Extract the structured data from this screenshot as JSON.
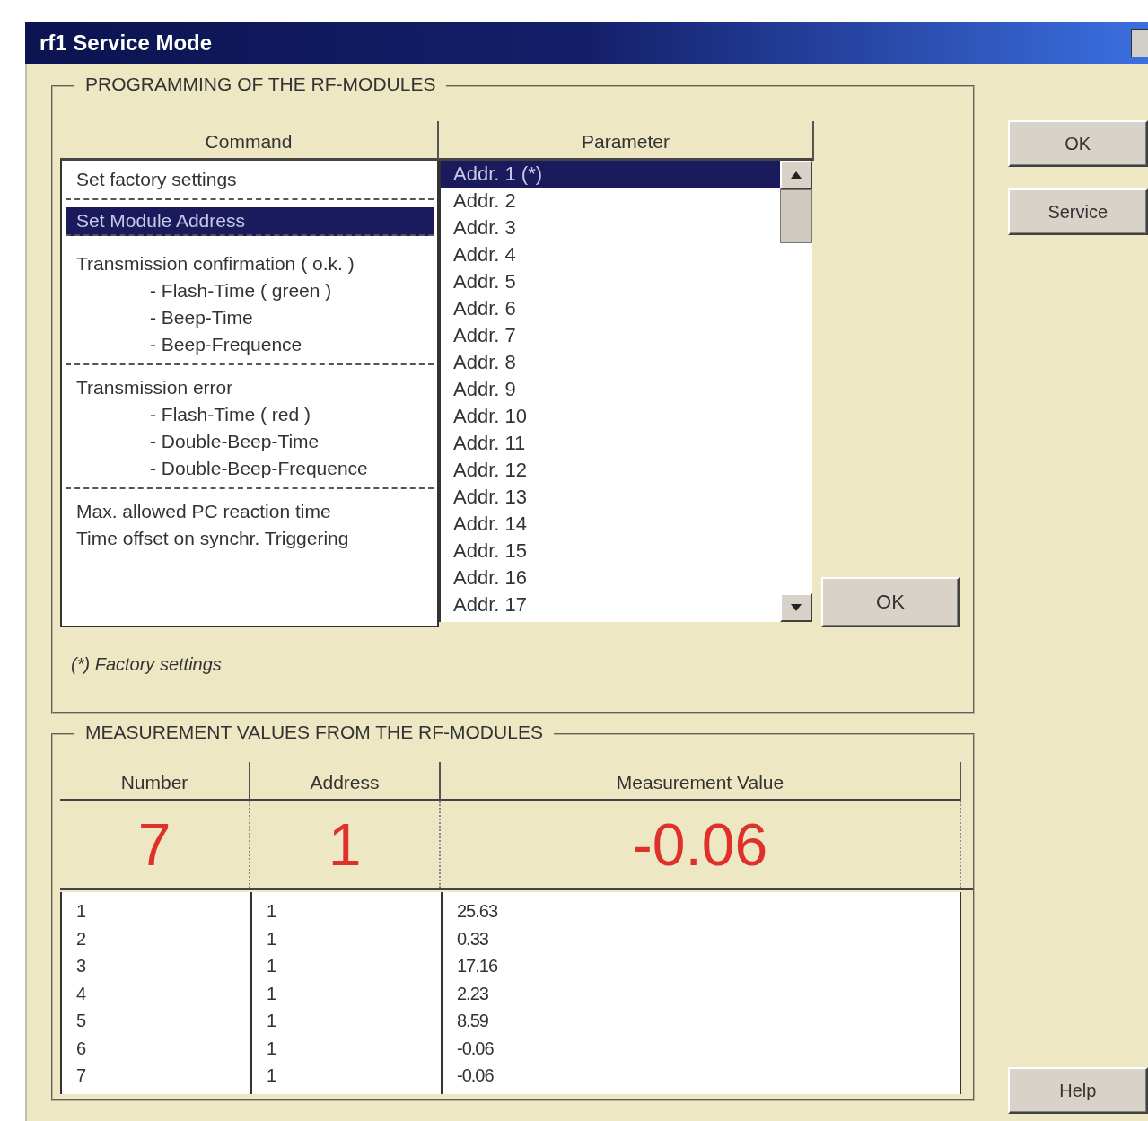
{
  "window": {
    "title": "rf1 Service Mode"
  },
  "programming": {
    "title": "PROGRAMMING OF THE RF-MODULES",
    "columns": [
      "Command",
      "Parameter"
    ],
    "commands": [
      {
        "selected": false,
        "lines": [
          {
            "kind": "main",
            "text": "Set factory settings"
          }
        ]
      },
      {
        "selected": true,
        "lines": [
          {
            "kind": "main",
            "text": "Set Module Address"
          }
        ]
      },
      {
        "selected": false,
        "lines": [
          {
            "kind": "main",
            "text": "Transmission confirmation ( o.k. )"
          },
          {
            "kind": "sub",
            "text": "- Flash-Time ( green )"
          },
          {
            "kind": "sub",
            "text": "- Beep-Time"
          },
          {
            "kind": "sub",
            "text": "- Beep-Frequence"
          }
        ]
      },
      {
        "selected": false,
        "lines": [
          {
            "kind": "main",
            "text": "Transmission error"
          },
          {
            "kind": "sub",
            "text": "- Flash-Time ( red )"
          },
          {
            "kind": "sub",
            "text": "- Double-Beep-Time"
          },
          {
            "kind": "sub",
            "text": "- Double-Beep-Frequence"
          }
        ]
      },
      {
        "selected": false,
        "lines": [
          {
            "kind": "main",
            "text": "Max. allowed PC reaction time"
          },
          {
            "kind": "main",
            "text": "Time offset on synchr. Triggering"
          }
        ]
      }
    ],
    "parameters": [
      {
        "text": "Addr. 1 (*)",
        "selected": true
      },
      {
        "text": "Addr. 2",
        "selected": false
      },
      {
        "text": "Addr. 3",
        "selected": false
      },
      {
        "text": "Addr. 4",
        "selected": false
      },
      {
        "text": "Addr. 5",
        "selected": false
      },
      {
        "text": "Addr. 6",
        "selected": false
      },
      {
        "text": "Addr. 7",
        "selected": false
      },
      {
        "text": "Addr. 8",
        "selected": false
      },
      {
        "text": "Addr. 9",
        "selected": false
      },
      {
        "text": "Addr. 10",
        "selected": false
      },
      {
        "text": "Addr. 11",
        "selected": false
      },
      {
        "text": "Addr. 12",
        "selected": false
      },
      {
        "text": "Addr. 13",
        "selected": false
      },
      {
        "text": "Addr. 14",
        "selected": false
      },
      {
        "text": "Addr. 15",
        "selected": false
      },
      {
        "text": "Addr. 16",
        "selected": false
      },
      {
        "text": "Addr. 17",
        "selected": false
      }
    ],
    "ok_button": "OK",
    "footnote": "(*) Factory settings"
  },
  "measurement": {
    "title": "MEASUREMENT VALUES FROM THE RF-MODULES",
    "columns": [
      "Number",
      "Address",
      "Measurement Value"
    ],
    "current": {
      "number": "7",
      "address": "1",
      "value": "-0.06"
    },
    "rows": [
      {
        "number": "1",
        "address": "1",
        "value": "25.63"
      },
      {
        "number": "2",
        "address": "1",
        "value": "0.33"
      },
      {
        "number": "3",
        "address": "1",
        "value": "17.16"
      },
      {
        "number": "4",
        "address": "1",
        "value": "2.23"
      },
      {
        "number": "5",
        "address": "1",
        "value": "8.59"
      },
      {
        "number": "6",
        "address": "1",
        "value": "-0.06"
      },
      {
        "number": "7",
        "address": "1",
        "value": "-0.06"
      }
    ]
  },
  "side_buttons": [
    "OK",
    "Service",
    "Help"
  ]
}
